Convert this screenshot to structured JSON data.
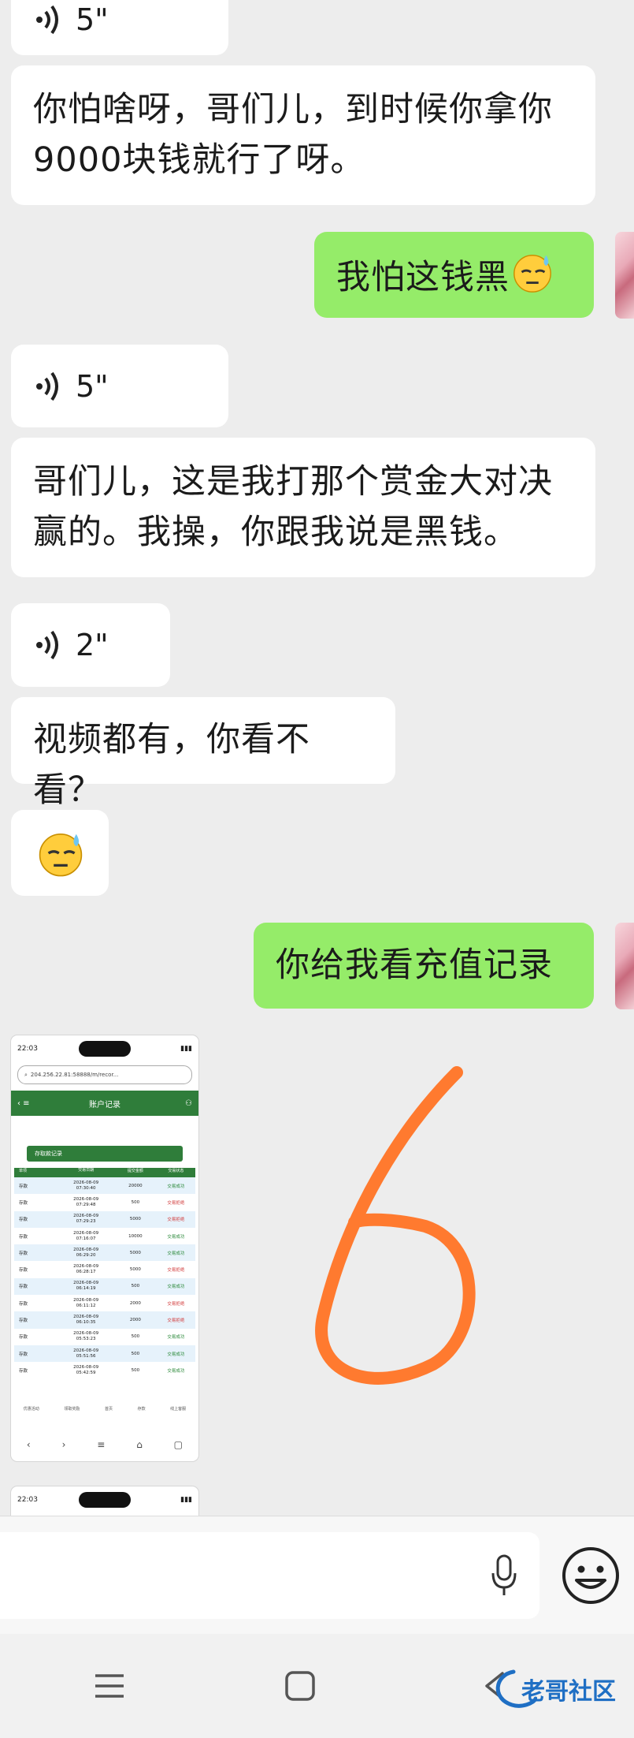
{
  "messages": [
    {
      "type": "voice",
      "side": "in",
      "duration": "5\""
    },
    {
      "type": "text",
      "side": "in",
      "lines": [
        "你怕啥呀，哥们儿，到时候你拿你",
        "9000块钱就行了呀。"
      ]
    },
    {
      "type": "text",
      "side": "out",
      "text": "我怕这钱黑"
    },
    {
      "type": "voice",
      "side": "in",
      "duration": "5\""
    },
    {
      "type": "text",
      "side": "in",
      "lines": [
        "哥们儿，这是我打那个赏金大对决",
        "赢的。我操，你跟我说是黑钱。"
      ]
    },
    {
      "type": "voice",
      "side": "in",
      "duration": "2\""
    },
    {
      "type": "text",
      "side": "in",
      "text": "视频都有，你看不看？"
    },
    {
      "type": "emoji",
      "side": "in",
      "name": "sweat-emoji"
    },
    {
      "type": "text",
      "side": "out",
      "text": "你给我看充值记录"
    }
  ],
  "thumbnail": {
    "time": "22:03",
    "url": "204.256.22.81:58888/m/recor...",
    "title": "账户记录",
    "button": "存取款记录",
    "headers": [
      "单项",
      "交易日期",
      "提交金额",
      "交易状态"
    ],
    "rows": [
      {
        "type": "存款",
        "date": "2026-08-09",
        "time": "07:30:40",
        "amount": "20000",
        "status": "交易成功",
        "status_color": "#2e8b3d"
      },
      {
        "type": "存款",
        "date": "2026-08-09",
        "time": "07:29:48",
        "amount": "500",
        "status": "交易拒绝",
        "status_color": "#d23b3b"
      },
      {
        "type": "存款",
        "date": "2026-08-09",
        "time": "07:29:23",
        "amount": "5000",
        "status": "交易拒绝",
        "status_color": "#d23b3b"
      },
      {
        "type": "存款",
        "date": "2026-08-09",
        "time": "07:16:07",
        "amount": "10000",
        "status": "交易成功",
        "status_color": "#2e8b3d"
      },
      {
        "type": "存款",
        "date": "2026-08-09",
        "time": "06:29:20",
        "amount": "5000",
        "status": "交易成功",
        "status_color": "#2e8b3d"
      },
      {
        "type": "存款",
        "date": "2026-08-09",
        "time": "06:28:17",
        "amount": "5000",
        "status": "交易拒绝",
        "status_color": "#d23b3b"
      },
      {
        "type": "存款",
        "date": "2026-08-09",
        "time": "06:14:19",
        "amount": "500",
        "status": "交易成功",
        "status_color": "#2e8b3d"
      },
      {
        "type": "存款",
        "date": "2026-08-09",
        "time": "06:11:12",
        "amount": "2000",
        "status": "交易拒绝",
        "status_color": "#d23b3b"
      },
      {
        "type": "存款",
        "date": "2026-08-09",
        "time": "06:10:35",
        "amount": "2000",
        "status": "交易拒绝",
        "status_color": "#d23b3b"
      },
      {
        "type": "存款",
        "date": "2026-08-09",
        "time": "05:53:23",
        "amount": "500",
        "status": "交易成功",
        "status_color": "#2e8b3d"
      },
      {
        "type": "存款",
        "date": "2026-08-09",
        "time": "05:51:56",
        "amount": "500",
        "status": "交易成功",
        "status_color": "#2e8b3d"
      },
      {
        "type": "存款",
        "date": "2026-08-09",
        "time": "05:42:59",
        "amount": "500",
        "status": "交易成功",
        "status_color": "#2e8b3d"
      }
    ],
    "nav": [
      "优惠活动",
      "领取奖励",
      "首页",
      "存款",
      "线上客服"
    ]
  },
  "colors": {
    "outgoing": "#95ec69",
    "incoming": "#ffffff",
    "background": "#ededed",
    "drawing": "#ff7a2f"
  },
  "watermark": "老哥社区"
}
